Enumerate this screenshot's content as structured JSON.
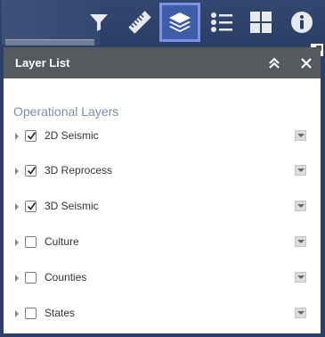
{
  "toolbar": {
    "tools": [
      {
        "icon": "filter-icon"
      },
      {
        "icon": "measure-icon"
      },
      {
        "icon": "layers-icon",
        "active": true
      },
      {
        "icon": "legend-icon"
      },
      {
        "icon": "basemap-gallery-icon"
      },
      {
        "icon": "info-icon"
      }
    ]
  },
  "panel": {
    "title": "Layer List",
    "section_title": "Operational Layers",
    "layers": [
      {
        "name": "2D Seismic",
        "checked": true
      },
      {
        "name": "3D Reprocess",
        "checked": true
      },
      {
        "name": "3D Seismic",
        "checked": true
      },
      {
        "name": "Culture",
        "checked": false
      },
      {
        "name": "Counties",
        "checked": false
      },
      {
        "name": "States",
        "checked": false
      }
    ]
  },
  "colors": {
    "toolbar_bg": "#2c3f66",
    "active_tool_border": "#7e91e8",
    "header_bg": "#555a5f",
    "section_title": "#7a8ba3"
  }
}
